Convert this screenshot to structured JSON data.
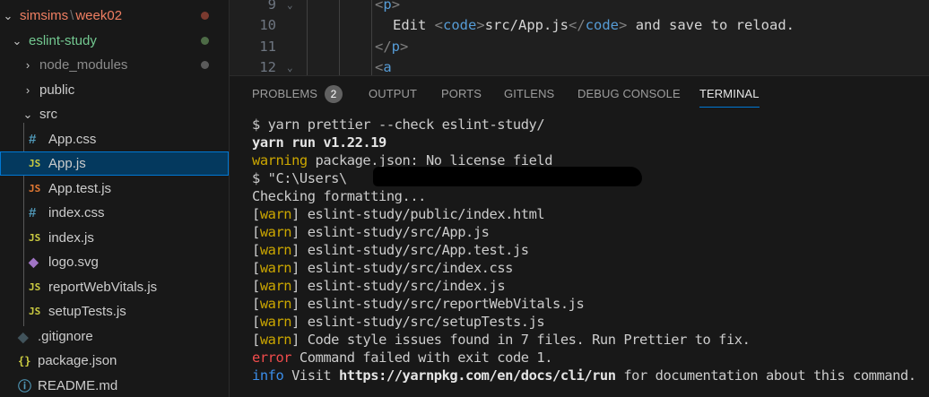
{
  "explorer": {
    "breadcrumb": {
      "root": "simsims",
      "separator": "\\",
      "folder": "week02"
    },
    "project": "eslint-study",
    "items": [
      {
        "label": "node_modules",
        "type": "folder",
        "expanded": false
      },
      {
        "label": "public",
        "type": "folder",
        "expanded": false
      },
      {
        "label": "src",
        "type": "folder",
        "expanded": true
      },
      {
        "label": "App.css",
        "type": "css",
        "icon": "#"
      },
      {
        "label": "App.js",
        "type": "js",
        "icon": "JS",
        "selected": true
      },
      {
        "label": "App.test.js",
        "type": "test-js",
        "icon": "JS"
      },
      {
        "label": "index.css",
        "type": "css",
        "icon": "#"
      },
      {
        "label": "index.js",
        "type": "js",
        "icon": "JS"
      },
      {
        "label": "logo.svg",
        "type": "svg",
        "icon": "◆"
      },
      {
        "label": "reportWebVitals.js",
        "type": "js",
        "icon": "JS"
      },
      {
        "label": "setupTests.js",
        "type": "js",
        "icon": "JS"
      },
      {
        "label": ".gitignore",
        "type": "git",
        "icon": "◆"
      },
      {
        "label": "package.json",
        "type": "json",
        "icon": "{}"
      },
      {
        "label": "README.md",
        "type": "info",
        "icon": "ⓘ"
      }
    ],
    "dot_colors": {
      "root": "#7a3a2f",
      "project": "#4d6b46",
      "node_modules": "#5a5a5a"
    }
  },
  "editor": {
    "lines": [
      {
        "number": "9",
        "open": "<",
        "tag": "p",
        "close": ">"
      },
      {
        "number": "10",
        "pre": "Edit ",
        "open": "<",
        "tag": "code",
        "close": ">",
        "mid": "src/App.js",
        "open2": "</",
        "tag2": "code",
        "close2": ">",
        "post": " and save to reload."
      },
      {
        "number": "11",
        "open": "</",
        "tag": "p",
        "close": ">"
      },
      {
        "number": "12",
        "open": "<",
        "tag": "a",
        "close": ""
      }
    ]
  },
  "panel": {
    "tabs": [
      "PROBLEMS",
      "OUTPUT",
      "PORTS",
      "GITLENS",
      "DEBUG CONSOLE",
      "TERMINAL"
    ],
    "problems_count": "2",
    "active_tab": "TERMINAL"
  },
  "terminal": {
    "cmd": "$ yarn prettier --check eslint-study/",
    "yarn_version": "yarn run v1.22.19",
    "warning_word": "warning",
    "warning_text": " package.json: No license field",
    "path_cmd": "$ \"C:\\Users\\",
    "checking": "Checking formatting...",
    "warn_word": "warn",
    "warn_files": [
      "eslint-study/public/index.html",
      "eslint-study/src/App.js",
      "eslint-study/src/App.test.js",
      "eslint-study/src/index.css",
      "eslint-study/src/index.js",
      "eslint-study/src/reportWebVitals.js",
      "eslint-study/src/setupTests.js"
    ],
    "summary": " Code style issues found in 7 files. Run Prettier to fix.",
    "error_word": "error",
    "error_text": " Command failed with exit code 1.",
    "info_word": "info",
    "info_pre": " Visit ",
    "info_url": "https://yarnpkg.com/en/docs/cli/run",
    "info_post": " for documentation about this command."
  },
  "colors": {
    "accent": "#0078d4",
    "warning": "#cca700",
    "error": "#f14c4c",
    "info": "#3b8eea",
    "selection": "#04395e"
  }
}
